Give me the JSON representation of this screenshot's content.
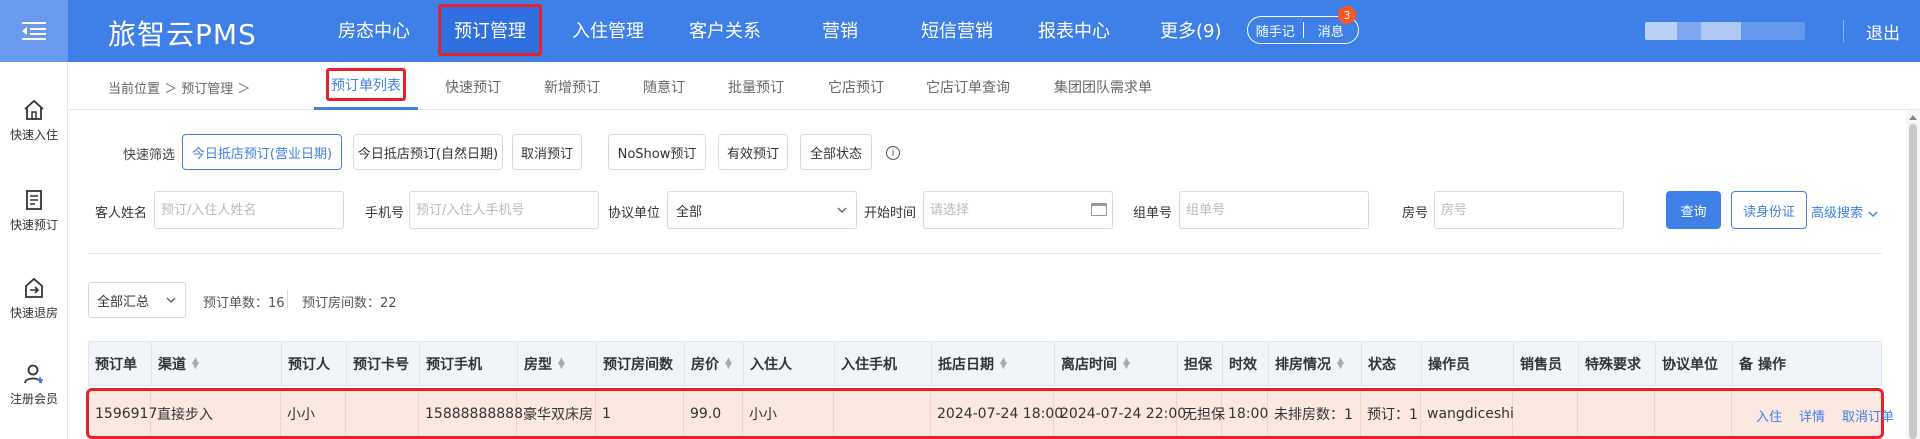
{
  "app": {
    "brand": "旅智云PMS",
    "logout": "退出"
  },
  "nav": [
    {
      "label": "房态中心"
    },
    {
      "label": "预订管理"
    },
    {
      "label": "入住管理"
    },
    {
      "label": "客户关系"
    },
    {
      "label": "营销"
    },
    {
      "label": "短信营销"
    },
    {
      "label": "报表中心"
    },
    {
      "label": "更多(9)"
    }
  ],
  "pill": {
    "notes": "随手记",
    "messages": "消息",
    "badge": "3"
  },
  "sidebar": [
    {
      "label": "快速入住",
      "icon": "home-icon"
    },
    {
      "label": "快速预订",
      "icon": "document-icon"
    },
    {
      "label": "快速退房",
      "icon": "checkout-icon"
    },
    {
      "label": "注册会员",
      "icon": "add-user-icon"
    }
  ],
  "breadcrumb": "当前位置 ＞ 预订管理 ＞",
  "tabs": [
    {
      "label": "预订单列表"
    },
    {
      "label": "快速预订"
    },
    {
      "label": "新增预订"
    },
    {
      "label": "随意订"
    },
    {
      "label": "批量预订"
    },
    {
      "label": "它店预订"
    },
    {
      "label": "它店订单查询"
    },
    {
      "label": "集团团队需求单"
    }
  ],
  "quick_filter": {
    "label": "快速筛选",
    "buttons": [
      {
        "label": "今日抵店预订(营业日期)"
      },
      {
        "label": "今日抵店预订(自然日期)"
      },
      {
        "label": "取消预订"
      },
      {
        "label": "NoShow预订"
      },
      {
        "label": "有效预订"
      },
      {
        "label": "全部状态"
      }
    ]
  },
  "filters": {
    "guest_name": {
      "label": "客人姓名",
      "placeholder": "预订/入住人姓名"
    },
    "phone": {
      "label": "手机号",
      "placeholder": "预订/入住人手机号"
    },
    "agreement": {
      "label": "协议单位",
      "value": "全部"
    },
    "start_time": {
      "label": "开始时间",
      "placeholder": "请选择"
    },
    "group_no": {
      "label": "组单号",
      "placeholder": "组单号"
    },
    "room_no": {
      "label": "房号",
      "placeholder": "房号"
    },
    "query_btn": "查询",
    "idcard_btn": "读身份证",
    "advanced": "高级搜索"
  },
  "summary": {
    "select_value": "全部汇总",
    "order_count": "预订单数：16",
    "room_count": "预订房间数：22"
  },
  "table": {
    "headers": [
      "预订单",
      "渠道",
      "预订人",
      "预订卡号",
      "预订手机",
      "房型",
      "预订房间数",
      "房价",
      "入住人",
      "入住手机",
      "抵店日期",
      "离店时间",
      "担保",
      "时效",
      "排房情况",
      "状态",
      "操作员",
      "销售员",
      "特殊要求",
      "协议单位",
      "备",
      "操作"
    ],
    "rows": [
      {
        "cells": [
          "1596917",
          "直接步入",
          "小小",
          "",
          "15888888888",
          "豪华双床房",
          "1",
          "99.0",
          "小小",
          "",
          "2024-07-24 18:00",
          "2024-07-24 22:00",
          "无担保",
          "18:00",
          "未排房数：1",
          "预订：1",
          "wangdiceshi",
          "",
          "",
          "",
          ""
        ],
        "actions": [
          "入住",
          "详情",
          "取消订单"
        ]
      }
    ]
  },
  "colors": {
    "primary": "#3f7fe8",
    "highlight": "#e8202a",
    "row_bg": "#fbe8e1"
  }
}
